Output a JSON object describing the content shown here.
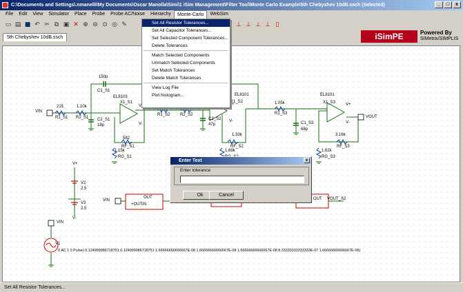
{
  "window": {
    "title": "C:\\Documents and Settings\\.nmanelli\\My Documents\\Oscar Manolla\\Simi\\1 iSim Management\\Filter Tool\\Monte Carlo Example\\5th Chebyshev 10dB.ssch (Selected)",
    "min": "_",
    "max": "□",
    "close": "x"
  },
  "menubar": [
    "File",
    "Edit",
    "View",
    "Simulator",
    "Place",
    "Probe",
    "Probe AC/Noise",
    "Hierarchy",
    "Monte-Carlo",
    "WebSim"
  ],
  "toolbar_icons": [
    "new-icon",
    "open-icon",
    "save-icon",
    "undo-icon",
    "cut-icon",
    "copy-icon",
    "paste-icon",
    "delete-icon",
    "zoom-in-icon",
    "zoom-out-icon",
    "zoom-fit-icon",
    "zoom-area-icon",
    "pencil-icon"
  ],
  "tab": {
    "label": "5th Chebyshev 10dB.ssch"
  },
  "logo": {
    "brand": "iSimPE",
    "powered": "Powered By",
    "sub": "SIMetrix/SIMPLIS"
  },
  "dropdown": {
    "items": [
      "Set All Resistor Tolerances...",
      "Set All Capacitor Tolerances...",
      "Set Selected Component Tolerances...",
      "Delete Tolerances",
      "Match Selected Components",
      "Unmatch Selected Components",
      "Set Match Tolerances",
      "Delete Match Tolerances",
      "View Log File",
      "Plot histogram..."
    ]
  },
  "dialog": {
    "title": "Enter Text",
    "group_label": "Enter tolerance",
    "value": "",
    "ok": "Ok",
    "cancel": "Cancel"
  },
  "schematic": {
    "vin": "VIN",
    "vout": "VOUT",
    "r1_s1": "R1_S1",
    "r1_s1_val": "215",
    "r2_s1": "R2_S1",
    "r2_s1_val": "1.10k",
    "c1_s1": "C1_S1",
    "c1_s1_val": "150p",
    "c2_s1": "C2_S1",
    "c2_s1_val": "18p",
    "x1_s1": "X1_S1",
    "el1": "EL8103",
    "rf_s1": "RF_S1",
    "rf_s1_val": "582",
    "rg_s1": "RG_S1",
    "rg_s1_val": "1.15k",
    "r1_s2": "R1_S2",
    "r2_s2": "R2_S2",
    "c2_s2": "C2_S2",
    "c2_s2_val": "47p",
    "x1_s2": "X1_S2",
    "el2": "EL8101",
    "rf_s2": "RF_S2",
    "rf_s2_val": "1.33k",
    "rg_s2": "RG_S2",
    "rg_s2_val": "1.69k",
    "r1_s3": "R1_S3",
    "r1_s3_val": "1.05k",
    "c1_s3": "C1_S3",
    "c1_s3_val": "68p",
    "x1_s3": "X1_S3",
    "el3": "EL8101",
    "rf_s3": "RF_S3",
    "rf_s3_val": "3.16k",
    "rg_s3": "RG_S3",
    "rg_s3_val": "1.62k",
    "vplus": "V+",
    "vminus": "V-",
    "v2": "V2",
    "v2_val": "2.5",
    "v3": "V3",
    "v3_val": "2.5",
    "vin2": "VIN",
    "v1": "V1",
    "out_block": "OUT",
    "outin_block": "+OUTIN",
    "vout_s2": "VOUT_S2",
    "v1_def": "0 AC 1 0 Pulse(-0.124999986718751 0.124999986718751 1.66666666666667E-08 1.66666666666667E-08 1.66666666666667E-08 8.33333333333333E-07 1.66666666666667E-06)"
  },
  "status": "Set All Resistor Tolerances..."
}
